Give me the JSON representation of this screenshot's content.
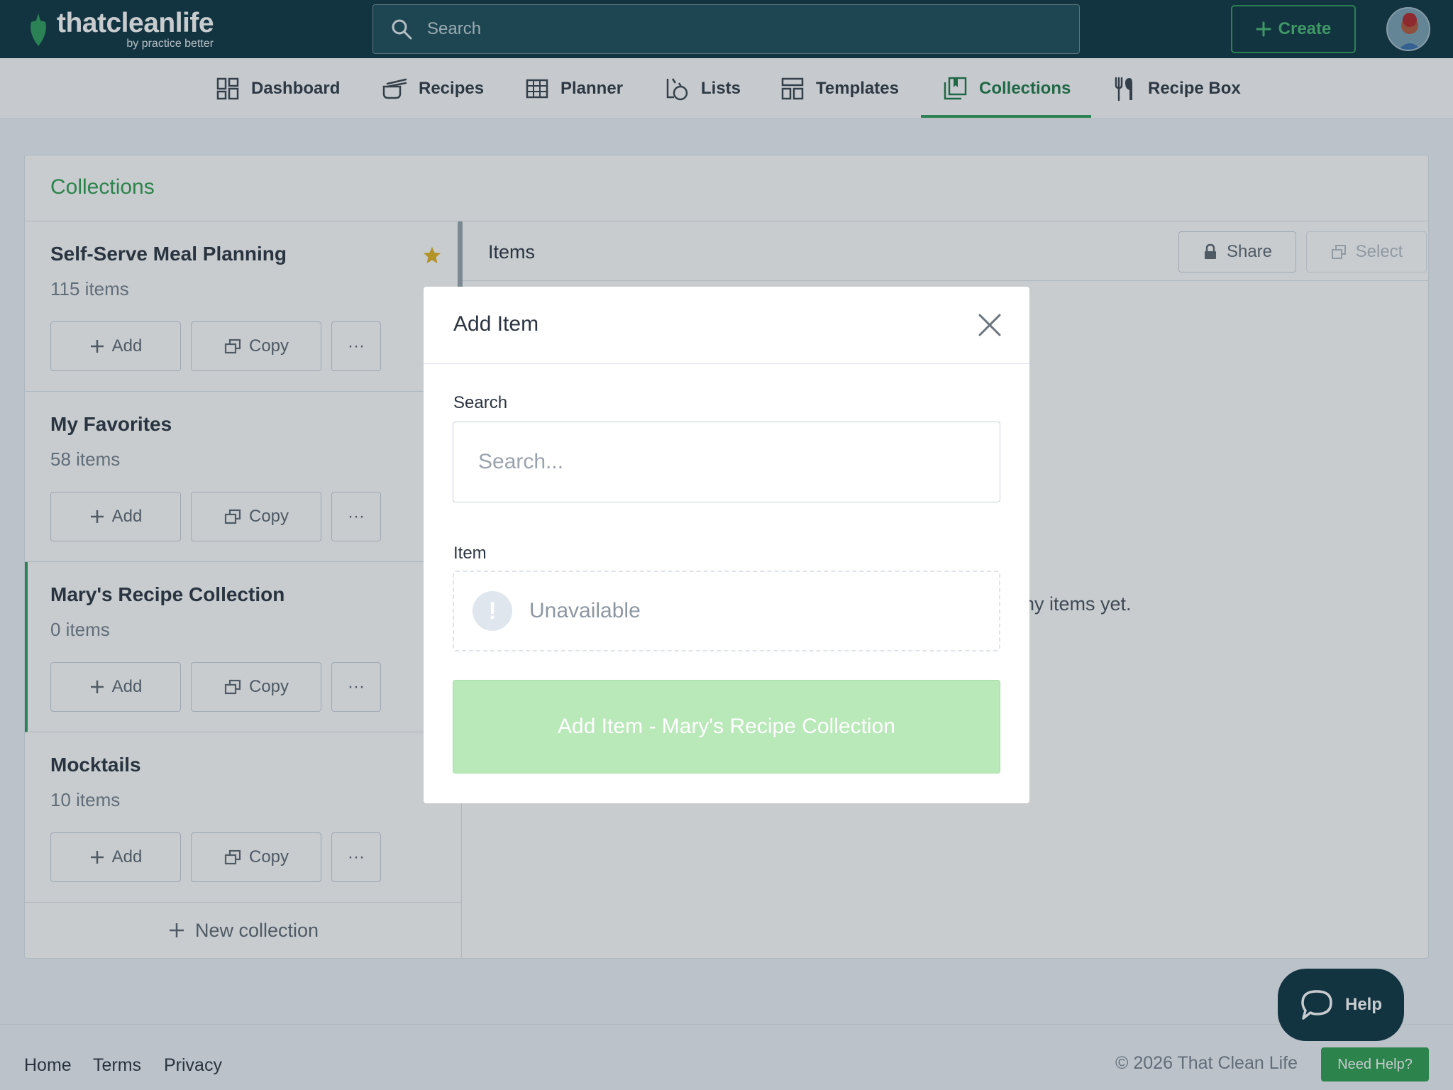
{
  "brand": {
    "name": "thatcleanlife",
    "sub": "by practice better"
  },
  "topbar": {
    "search_placeholder": "Search",
    "create_label": "Create"
  },
  "nav": {
    "items": [
      {
        "label": "Dashboard",
        "icon": "dashboard-icon"
      },
      {
        "label": "Recipes",
        "icon": "recipes-icon"
      },
      {
        "label": "Planner",
        "icon": "planner-icon"
      },
      {
        "label": "Lists",
        "icon": "lists-icon"
      },
      {
        "label": "Templates",
        "icon": "templates-icon"
      },
      {
        "label": "Collections",
        "icon": "collections-icon",
        "active": true
      },
      {
        "label": "Recipe Box",
        "icon": "recipe-box-icon"
      }
    ]
  },
  "page": {
    "title": "Collections",
    "new_collection": "New collection",
    "collections": [
      {
        "name": "Self-Serve Meal Planning",
        "count": "115 items",
        "starred": true
      },
      {
        "name": "My Favorites",
        "count": "58 items",
        "starred": false
      },
      {
        "name": "Mary's Recipe Collection",
        "count": "0 items",
        "selected": true
      },
      {
        "name": "Mocktails",
        "count": "10 items",
        "starred": false
      }
    ],
    "buttons": {
      "add": "Add",
      "copy": "Copy",
      "more": "···"
    },
    "items_panel": {
      "title": "Items",
      "share": "Share",
      "select": "Select",
      "empty_text_visible": "ny items yet."
    }
  },
  "modal": {
    "title": "Add Item",
    "search_label": "Search",
    "search_placeholder": "Search...",
    "item_label": "Item",
    "item_status": "Unavailable",
    "warn_glyph": "!",
    "submit_label": "Add Item - Mary's Recipe Collection"
  },
  "footer": {
    "links": [
      "Home",
      "Terms",
      "Privacy"
    ],
    "copyright": "© 2026 That Clean Life",
    "need_help": "Need Help?"
  },
  "help_bubble": {
    "label": "Help"
  },
  "colors": {
    "brand_dark": "#0d3440",
    "accent_green": "#2f9e4f",
    "submit_disabled": "#b9e8b9",
    "star": "#e2b320"
  }
}
